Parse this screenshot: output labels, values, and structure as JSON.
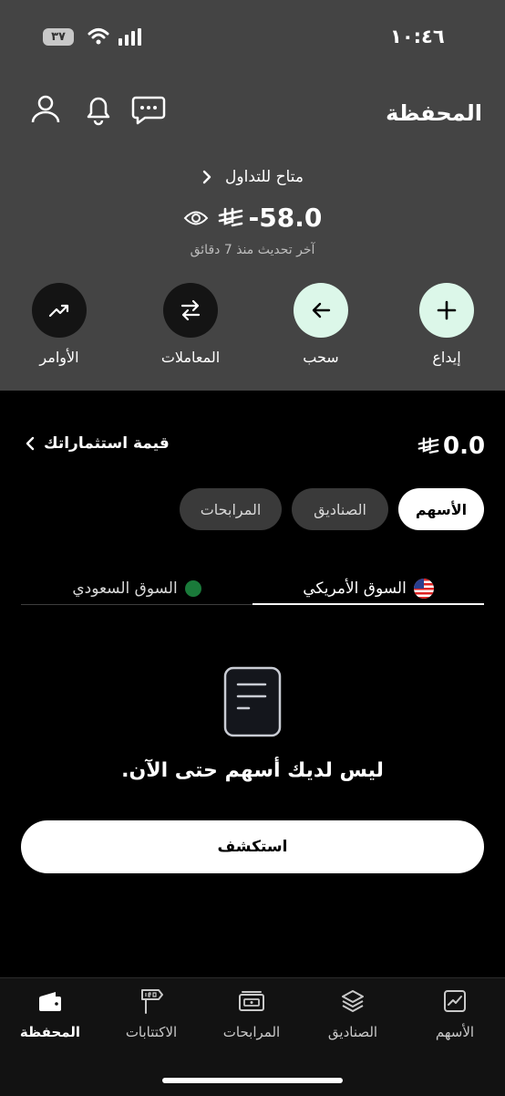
{
  "status": {
    "time": "١٠:٤٦",
    "battery": "٣٧"
  },
  "header": {
    "title": "المحفظة",
    "icons": [
      "chat-icon",
      "bell-icon",
      "user-icon"
    ],
    "available_label": "متاح للتداول",
    "balance": "-58.0",
    "updated": "آخر تحديث منذ 7 دقائق"
  },
  "actions": [
    {
      "label": "إيداع",
      "icon": "plus-icon"
    },
    {
      "label": "سحب",
      "icon": "arrow-left-icon"
    },
    {
      "label": "المعاملات",
      "icon": "swap-icon"
    },
    {
      "label": "الأوامر",
      "icon": "trend-icon"
    }
  ],
  "investments": {
    "value": "0.0",
    "label": "قيمة استثماراتك"
  },
  "asset_tabs": [
    "الأسهم",
    "الصناديق",
    "المرابحات"
  ],
  "market_tabs": [
    "السوق الأمريكي",
    "السوق السعودي"
  ],
  "empty_state": {
    "message": "ليس لديك أسهم حتى الآن.",
    "button": "استكشف"
  },
  "nav": [
    {
      "label": "الأسهم",
      "icon": "chart-icon"
    },
    {
      "label": "الصناديق",
      "icon": "layers-icon"
    },
    {
      "label": "المرابحات",
      "icon": "wallet-cards-icon"
    },
    {
      "label": "الاكتتابات",
      "icon": "ipo-sign-icon"
    },
    {
      "label": "المحفظة",
      "icon": "portfolio-icon"
    }
  ],
  "colors": {
    "header_bg": "#444444",
    "accent_light": "#dcf7e9",
    "background": "#000000"
  }
}
